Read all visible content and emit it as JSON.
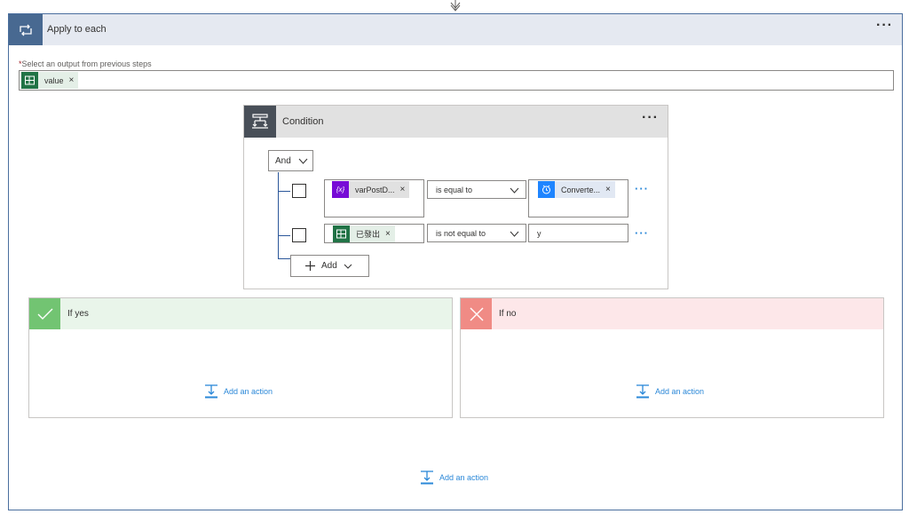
{
  "apply_to_each": {
    "title": "Apply to each",
    "more_label": "···",
    "required_marker": "*",
    "field_label": "Select an output from previous steps",
    "value_token": {
      "label": "value",
      "icon": "excel-icon",
      "close": "×"
    }
  },
  "condition": {
    "title": "Condition",
    "more_label": "···",
    "group_operator": "And",
    "rows": [
      {
        "left_token": {
          "label": "varPostD...",
          "icon": "variable-icon",
          "close": "×"
        },
        "operator": "is equal to",
        "right_token": {
          "label": "Converte...",
          "icon": "clock-icon",
          "close": "×"
        },
        "more_label": "···"
      },
      {
        "left_token": {
          "label": "已發出",
          "icon": "excel-icon",
          "close": "×"
        },
        "operator": "is not equal to",
        "right_value": "y",
        "more_label": "···"
      }
    ],
    "add_label": "Add"
  },
  "branches": {
    "yes": {
      "title": "If yes",
      "add_action": "Add an action"
    },
    "no": {
      "title": "If no",
      "add_action": "Add an action"
    }
  },
  "footer": {
    "add_action": "Add an action"
  },
  "colors": {
    "apply_header_bg": "#e5e9f1",
    "apply_icon_bg": "#486991",
    "condition_icon_bg": "#484f58",
    "yes_bg": "#e9f5ea",
    "yes_icon": "#72c472",
    "no_bg": "#fde7e9",
    "no_icon": "#f08b85",
    "link": "#2b88d8",
    "excel": "#217346",
    "variable": "#770bd6",
    "clock": "#1f85ff"
  }
}
